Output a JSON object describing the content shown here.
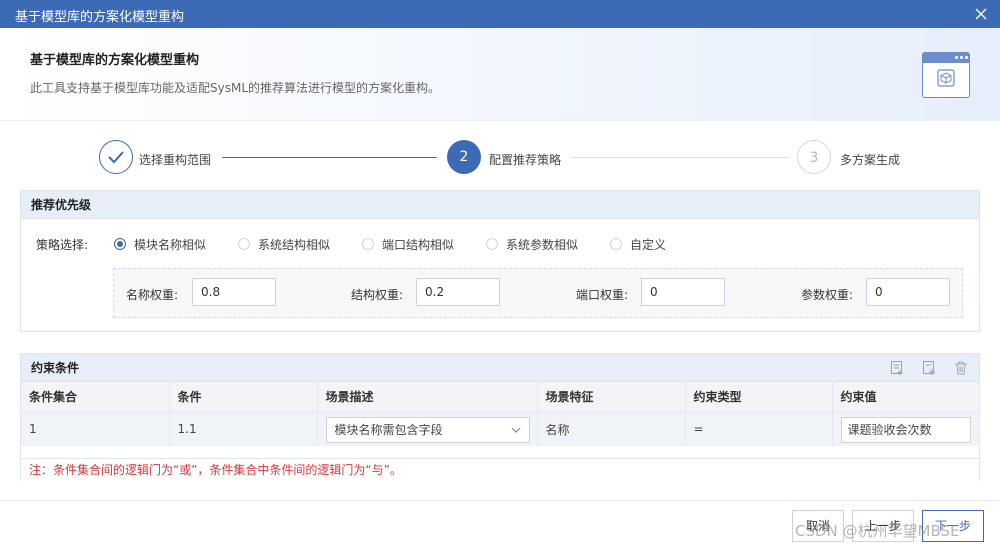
{
  "window": {
    "title": "基于模型库的方案化模型重构"
  },
  "header": {
    "title": "基于模型库的方案化模型重构",
    "subtitle": "此工具支持基于模型库功能及适配SysML的推荐算法进行模型的方案化重构。",
    "icon": "package-box-icon"
  },
  "steps": [
    {
      "number": "✓",
      "label": "选择重构范围",
      "state": "done"
    },
    {
      "number": "2",
      "label": "配置推荐策略",
      "state": "active"
    },
    {
      "number": "3",
      "label": "多方案生成",
      "state": "pending"
    }
  ],
  "priority": {
    "title": "推荐优先级",
    "strategy_label": "策略选择:",
    "options": [
      "模块名称相似",
      "系统结构相似",
      "端口结构相似",
      "系统参数相似",
      "自定义"
    ],
    "selected": "模块名称相似",
    "weights": [
      {
        "label": "名称权重:",
        "value": "0.8"
      },
      {
        "label": "结构权重:",
        "value": "0.2"
      },
      {
        "label": "端口权重:",
        "value": "0"
      },
      {
        "label": "参数权重:",
        "value": "0"
      }
    ]
  },
  "constraints": {
    "title": "约束条件",
    "columns": [
      "条件集合",
      "条件",
      "场景描述",
      "场景特征",
      "约束类型",
      "约束值"
    ],
    "rows": [
      {
        "set": "1",
        "cond": "1.1",
        "scene": "模块名称需包含字段",
        "feature": "名称",
        "type": "=",
        "value": "课题验收会次数"
      }
    ],
    "note": "注：条件集合间的逻辑门为“或”，条件集合中条件间的逻辑门为“与”。"
  },
  "footer": {
    "cancel": "取消",
    "prev": "上一步",
    "next": "下一步"
  },
  "watermark": "CSDN @杭州华望MBSE",
  "colors": {
    "primary": "#3c6ab5",
    "note_red": "#d9363e",
    "panel_head": "#e8eef8"
  }
}
